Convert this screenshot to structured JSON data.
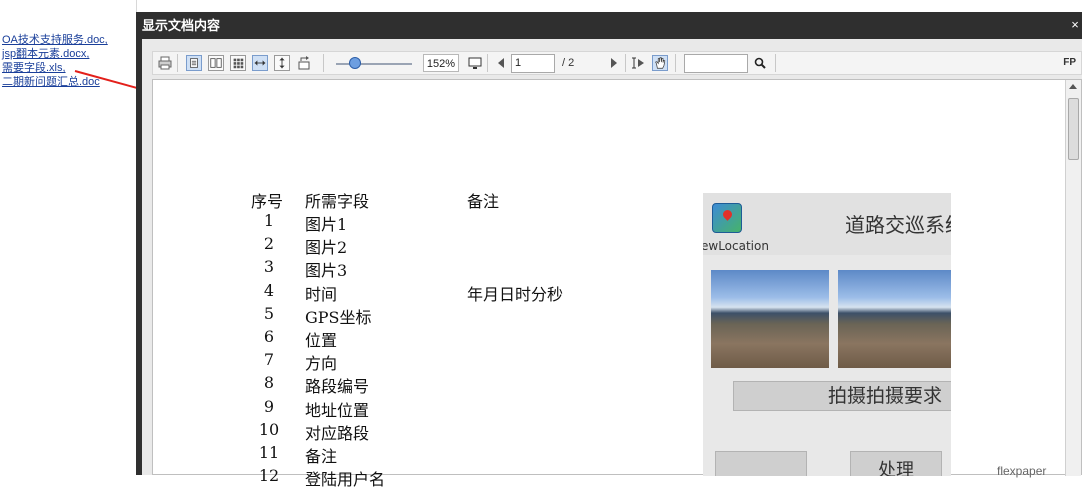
{
  "file_list": [
    "OA技术支持服务.doc,",
    "jsp翻本元素.docx,",
    "需要字段.xls,",
    "二期新问题汇总.doc"
  ],
  "dialog": {
    "title": "显示文档内容",
    "close_label": "×"
  },
  "toolbar": {
    "zoom_value": "152%",
    "page_input": "1",
    "page_total": "/ 2",
    "search_value": "",
    "fp_label": "FP"
  },
  "document": {
    "headers": {
      "no": "序号",
      "field": "所需字段",
      "note": "备注"
    },
    "rows": [
      {
        "no": "1",
        "field": "图片1",
        "note": ""
      },
      {
        "no": "2",
        "field": "图片2",
        "note": ""
      },
      {
        "no": "3",
        "field": "图片3",
        "note": ""
      },
      {
        "no": "4",
        "field": "时间",
        "note": "年月日时分秒"
      },
      {
        "no": "5",
        "field": "GPS坐标",
        "note": ""
      },
      {
        "no": "6",
        "field": "位置",
        "note": ""
      },
      {
        "no": "7",
        "field": "方向",
        "note": ""
      },
      {
        "no": "8",
        "field": "路段编号",
        "note": ""
      },
      {
        "no": "9",
        "field": "地址位置",
        "note": ""
      },
      {
        "no": "10",
        "field": "对应路段",
        "note": ""
      },
      {
        "no": "11",
        "field": "备注",
        "note": ""
      },
      {
        "no": "12",
        "field": "登陆用户名",
        "note": ""
      }
    ],
    "phone": {
      "app_subtitle": "ewLocation",
      "app_title": "道路交巡系统",
      "shoot_button": "拍摄拍摄要求",
      "bottom_left": "",
      "bottom_right": "处理"
    },
    "watermark": "flexpaper"
  },
  "colors": {
    "dialog_bg": "#2f2f2f",
    "link": "#1a3f9a",
    "arrow": "#e3201b"
  }
}
